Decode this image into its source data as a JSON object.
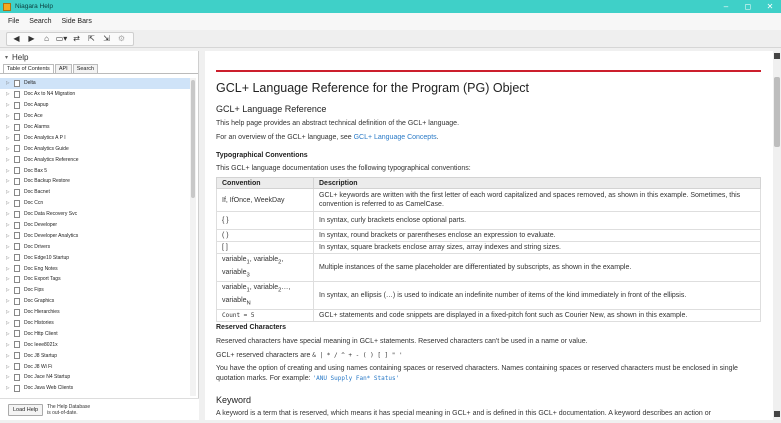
{
  "window": {
    "title": "Niagara Help",
    "minimize_glyph": "–",
    "maximize_glyph": "◻",
    "close_glyph": "✕"
  },
  "menubar": {
    "items": [
      "File",
      "Search",
      "Side Bars"
    ]
  },
  "toolbar": {
    "icons": [
      {
        "name": "back-icon",
        "glyph": "◀"
      },
      {
        "name": "forward-icon",
        "glyph": "▶"
      },
      {
        "name": "home-icon",
        "glyph": "⌂"
      },
      {
        "name": "view-icon",
        "glyph": "▭▾"
      },
      {
        "name": "sync-icon",
        "glyph": "⇄"
      },
      {
        "name": "prev-topic-icon",
        "glyph": "⇱"
      },
      {
        "name": "next-topic-icon",
        "glyph": "⇲"
      },
      {
        "name": "settings-icon",
        "glyph": "⚙"
      }
    ]
  },
  "sidebar": {
    "title": "Help",
    "tabs": [
      "Table of Contents",
      "API",
      "Search"
    ],
    "items": [
      "Delta",
      "Doc Ax to N4 Migration",
      "Doc Aapup",
      "Doc Ace",
      "Doc Alarms",
      "Doc Analytics A P I",
      "Doc Analytics Guide",
      "Doc Analytics Reference",
      "Doc Bax 5",
      "Doc Backup Restore",
      "Doc Bacnet",
      "Doc Ccn",
      "Doc Data Recovery Svc",
      "Doc Developer",
      "Doc Developer Analytics",
      "Doc Drivers",
      "Doc Edge10 Startup",
      "Doc Eng Notes",
      "Doc Export Tags",
      "Doc Fips",
      "Doc Graphics",
      "Doc Hierarchies",
      "Doc Histories",
      "Doc Http Client",
      "Doc Ieee8021x",
      "Doc J8 Startup",
      "Doc J8 Wi Fi",
      "Doc Jace N4 Startup",
      "Doc Java Web Clients",
      "Doc Json Toolkit",
      "Doc Kit Control"
    ],
    "load_button": "Load Help",
    "footer_text_1": "The Help Database",
    "footer_text_2": "is out-of-date."
  },
  "content": {
    "title": "GCL+ Language Reference for the Program (PG) Object",
    "section1_heading": "GCL+ Language Reference",
    "para1": "This help page provides an abstract technical definition of the GCL+ language.",
    "para2_prefix": "For an overview of the GCL+ language, see ",
    "para2_link": "GCL+ Language Concepts",
    "para2_suffix": ".",
    "typo_heading": "Typographical Conventions",
    "typo_para": "This GCL+ language documentation uses the following typographical conventions:",
    "table": {
      "headers": [
        "Convention",
        "Description"
      ],
      "rows": [
        {
          "convention": "If, IfOnce, WeekDay",
          "description": "GCL+ keywords are written with the first letter of each word capitalized and spaces removed, as shown in this example. Sometimes, this convention is referred to as CamelCase."
        },
        {
          "convention": "{ }",
          "description": "In syntax, curly brackets enclose optional parts."
        },
        {
          "convention": "( )",
          "description": "In syntax, round brackets or parentheses enclose an expression to evaluate."
        },
        {
          "convention": "[ ]",
          "description": "In syntax, square brackets enclose array sizes, array indexes and string sizes."
        },
        {
          "convention": "variable1, variable2, variable3",
          "description": "Multiple instances of the same placeholder are differentiated by subscripts, as shown in the example."
        },
        {
          "convention": "variable1, variable2…, variableN",
          "description": "In syntax, an ellipsis (…) is used to indicate an indefinite number of items of the kind immediately in front of the ellipsis."
        },
        {
          "convention": "Count = 5",
          "description": "GCL+ statements and code snippets are displayed in a fixed-pitch font such as Courier New, as shown in this example."
        }
      ]
    },
    "reserved_heading": "Reserved Characters",
    "reserved_para": "Reserved characters have special meaning in GCL+ statements. Reserved characters can't be used in a name or value.",
    "reserved_list_prefix": "GCL+ reserved characters are ",
    "reserved_list_chars": "& | * / ^ + - ( ) [ ] \" '",
    "reserved_para2": "You have the option of creating and using names containing spaces or reserved characters. Names containing spaces or reserved characters must be enclosed in single quotation marks. For example: ",
    "reserved_example": "'ANU Supply Fan* Status'",
    "keyword_heading": "Keyword",
    "keyword_para": "A keyword is a term that is reserved, which means it has special meaning in GCL+ and is defined in this GCL+ documentation. A keyword describes an action or"
  }
}
